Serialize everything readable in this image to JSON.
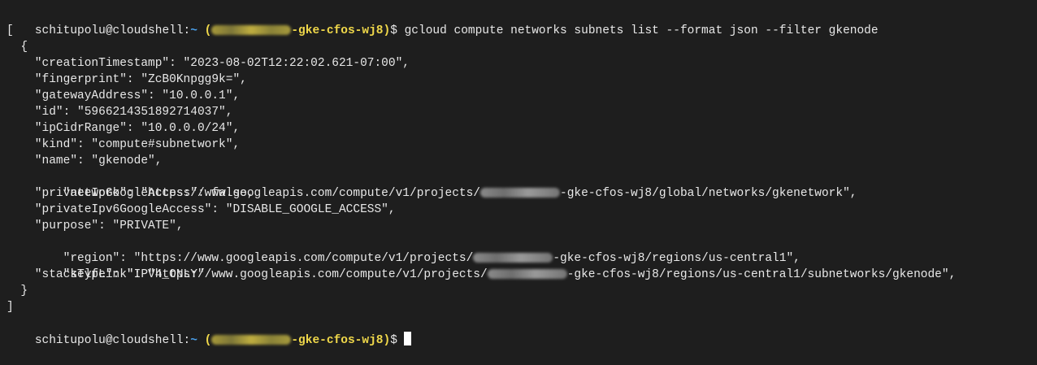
{
  "prompt": {
    "user_host": "schitupolu@cloudshell",
    "sep": ":",
    "path": "~",
    "project_open": "(",
    "project_suffix": "-gke-cfos-wj8",
    "project_close": ")",
    "dollar": "$"
  },
  "command": " gcloud compute networks subnets list --format json --filter gkenode",
  "output_lines": {
    "open_bracket": "[",
    "open_brace": "  {",
    "creationTimestamp": "    \"creationTimestamp\": \"2023-08-02T12:22:02.621-07:00\",",
    "fingerprint": "    \"fingerprint\": \"ZcB0Knpgg9k=\",",
    "gatewayAddress": "    \"gatewayAddress\": \"10.0.0.1\",",
    "id": "    \"id\": \"5966214351892714037\",",
    "ipCidrRange": "    \"ipCidrRange\": \"10.0.0.0/24\",",
    "kind": "    \"kind\": \"compute#subnetwork\",",
    "name": "    \"name\": \"gkenode\",",
    "network_prefix": "    \"network\": \"https://www.googleapis.com/compute/v1/projects/",
    "network_suffix": "-gke-cfos-wj8/global/networks/gkenetwork\",",
    "privateIpGoogleAccess": "    \"privateIpGoogleAccess\": false,",
    "privateIpv6GoogleAccess": "    \"privateIpv6GoogleAccess\": \"DISABLE_GOOGLE_ACCESS\",",
    "purpose": "    \"purpose\": \"PRIVATE\",",
    "region_prefix": "    \"region\": \"https://www.googleapis.com/compute/v1/projects/",
    "region_suffix": "-gke-cfos-wj8/regions/us-central1\",",
    "selfLink_prefix": "    \"selfLink\": \"https://www.googleapis.com/compute/v1/projects/",
    "selfLink_suffix": "-gke-cfos-wj8/regions/us-central1/subnetworks/gkenode\",",
    "stackType": "    \"stackType\": \"IPV4_ONLY\"",
    "close_brace": "  }",
    "close_bracket": "]"
  },
  "colors": {
    "background": "#1e1e1e",
    "text": "#e8e8e8",
    "path": "#4a9ee8",
    "project": "#f0d84a"
  }
}
